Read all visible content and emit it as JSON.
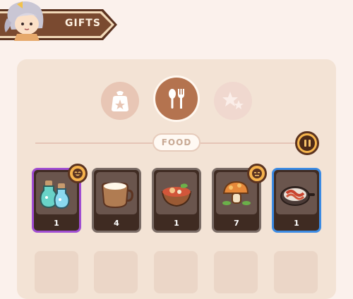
{
  "header": {
    "title": "GIFTS",
    "avatar_icon": "character-portrait-icon",
    "banner_color": "#7a4a30"
  },
  "categories": [
    {
      "name": "bag",
      "icon": "gift-bag-icon",
      "selected": false
    },
    {
      "name": "food",
      "icon": "spoon-fork-icon",
      "selected": true
    },
    {
      "name": "favorites",
      "icon": "stars-icon",
      "selected": false
    }
  ],
  "section_label": "FOOD",
  "sort_button_icon": "pause-sort-icon",
  "items": [
    {
      "icon": "potion-bottles-icon",
      "count": "1",
      "rarity": "purple",
      "badge": "happy-face-icon"
    },
    {
      "icon": "milk-cup-icon",
      "count": "4",
      "rarity": "grey",
      "badge": null
    },
    {
      "icon": "stew-bowl-icon",
      "count": "1",
      "rarity": "grey",
      "badge": null
    },
    {
      "icon": "mushroom-icon",
      "count": "7",
      "rarity": "grey",
      "badge": "neutral-face-icon"
    },
    {
      "icon": "bacon-pan-icon",
      "count": "1",
      "rarity": "blue",
      "badge": null
    }
  ],
  "colors": {
    "accent": "#f5b24c",
    "rarity_purple": "#a04ed2",
    "rarity_blue": "#3c8be3",
    "selected_tab": "#b4734f"
  }
}
